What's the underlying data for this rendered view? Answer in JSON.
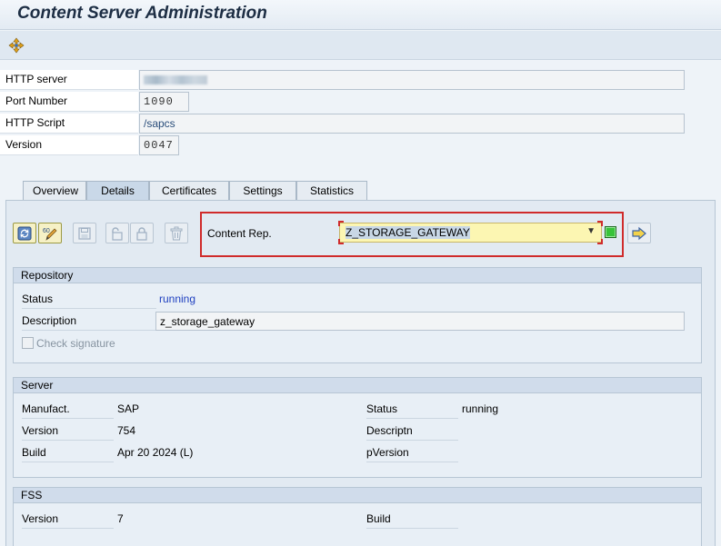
{
  "title": "Content Server Administration",
  "toolbar": {
    "icon": "move-object-icon"
  },
  "header_fields": {
    "http_server": {
      "label": "HTTP server",
      "value": ""
    },
    "port_number": {
      "label": "Port Number",
      "value": "1090"
    },
    "http_script": {
      "label": "HTTP Script",
      "value": "/sapcs"
    },
    "version": {
      "label": "Version",
      "value": "0047"
    }
  },
  "tabs": [
    {
      "label": "Overview",
      "active": false
    },
    {
      "label": "Details",
      "active": true
    },
    {
      "label": "Certificates",
      "active": false
    },
    {
      "label": "Settings",
      "active": false
    },
    {
      "label": "Statistics",
      "active": false
    }
  ],
  "content_rep": {
    "label": "Content Rep.",
    "value": "Z_STORAGE_GATEWAY",
    "status_color": "#38c33a"
  },
  "repository": {
    "title": "Repository",
    "status_label": "Status",
    "status_value": "running",
    "description_label": "Description",
    "description_value": "z_storage_gateway",
    "check_signature_label": "Check signature"
  },
  "server": {
    "title": "Server",
    "manufact_label": "Manufact.",
    "manufact_value": "SAP",
    "version_label": "Version",
    "version_value": "754",
    "build_label": "Build",
    "build_value": "Apr 20 2024 (L)",
    "status_label": "Status",
    "status_value": "running",
    "descriptn_label": "Descriptn",
    "descriptn_value": "",
    "pversion_label": "pVersion",
    "pversion_value": ""
  },
  "fss": {
    "title": "FSS",
    "version_label": "Version",
    "version_value": "7",
    "build_label": "Build",
    "build_value": ""
  }
}
